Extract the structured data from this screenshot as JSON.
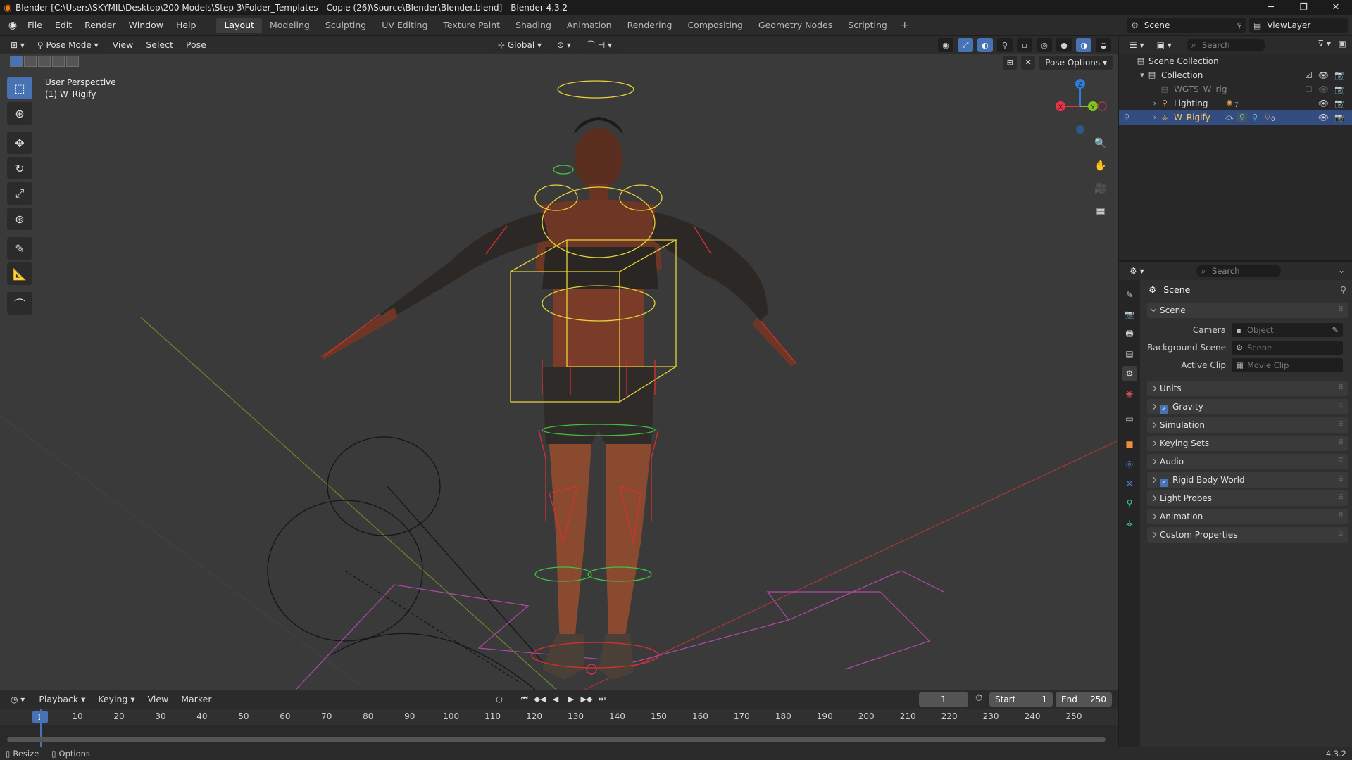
{
  "window": {
    "title": "Blender [C:\\Users\\SKYMIL\\Desktop\\200 Models\\Step 3\\Folder_Templates - Copie (26)\\Source\\Blender\\Blender.blend] - Blender 4.3.2"
  },
  "menu": [
    "File",
    "Edit",
    "Render",
    "Window",
    "Help"
  ],
  "workspaces": [
    "Layout",
    "Modeling",
    "Sculpting",
    "UV Editing",
    "Texture Paint",
    "Shading",
    "Animation",
    "Rendering",
    "Compositing",
    "Geometry Nodes",
    "Scripting"
  ],
  "active_workspace": "Layout",
  "scene_selector": "Scene",
  "view_layer": "ViewLayer",
  "viewport": {
    "mode": "Pose Mode",
    "menus": [
      "View",
      "Select",
      "Pose"
    ],
    "transform_orientation": "Global",
    "pose_options": "Pose Options",
    "perspective_label": "User Perspective",
    "object_label": "(1) W_Rigify",
    "gizmo_axes": [
      "X",
      "Y",
      "Z"
    ]
  },
  "tools": [
    "select-box",
    "cursor",
    "move",
    "rotate",
    "scale",
    "transform",
    "annotate",
    "measure",
    "relax"
  ],
  "timeline": {
    "menus": [
      "Playback",
      "Keying",
      "View",
      "Marker"
    ],
    "current_frame": "1",
    "start_label": "Start",
    "start": "1",
    "end_label": "End",
    "end": "250",
    "ruler_ticks": [
      "10",
      "20",
      "30",
      "40",
      "50",
      "60",
      "70",
      "80",
      "90",
      "100",
      "110",
      "120",
      "130",
      "140",
      "150",
      "160",
      "170",
      "180",
      "190",
      "200",
      "210",
      "220",
      "230",
      "240",
      "250"
    ]
  },
  "outliner": {
    "search_placeholder": "Search",
    "items": [
      {
        "label": "Scene Collection",
        "indent": 0
      },
      {
        "label": "Collection",
        "indent": 1
      },
      {
        "label": "WGTS_W_rig",
        "indent": 2
      },
      {
        "label": "Lighting",
        "indent": 2,
        "badge": "7"
      },
      {
        "label": "W_Rigify",
        "indent": 2,
        "selected": true,
        "badge": "0"
      }
    ]
  },
  "properties": {
    "search_placeholder": "Search",
    "context": "Scene",
    "scene_panel": "Scene",
    "fields": [
      {
        "label": "Camera",
        "placeholder": "Object"
      },
      {
        "label": "Background Scene",
        "placeholder": "Scene"
      },
      {
        "label": "Active Clip",
        "placeholder": "Movie Clip"
      }
    ],
    "panels": [
      {
        "label": "Units",
        "checkbox": false
      },
      {
        "label": "Gravity",
        "checkbox": true
      },
      {
        "label": "Simulation",
        "checkbox": false
      },
      {
        "label": "Keying Sets",
        "checkbox": false
      },
      {
        "label": "Audio",
        "checkbox": false
      },
      {
        "label": "Rigid Body World",
        "checkbox": true
      },
      {
        "label": "Light Probes",
        "checkbox": false
      },
      {
        "label": "Animation",
        "checkbox": false
      },
      {
        "label": "Custom Properties",
        "checkbox": false
      }
    ]
  },
  "statusbar": {
    "left": [
      "Resize",
      "Options"
    ],
    "version": "4.3.2"
  },
  "colors": {
    "accent": "#4772b3",
    "viewport_bg": "#3a3a3a",
    "selected_row": "#334d80",
    "axis_x": "#e8324a",
    "axis_y": "#84c41c",
    "axis_z": "#2e7ed4",
    "bone_yellow": "#e6d23a",
    "bone_red": "#d83030",
    "bone_green": "#40c040"
  }
}
